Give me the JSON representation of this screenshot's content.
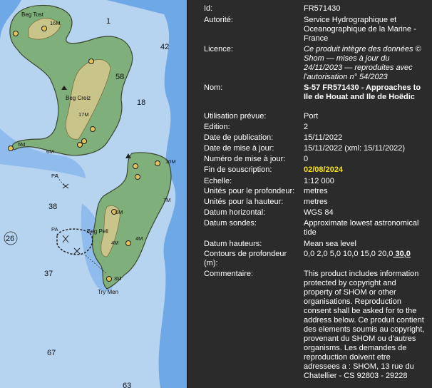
{
  "chart_map": {
    "place_labels": [
      "Beg Tost",
      "Beg Creiz",
      "Beg Pell",
      "Try Men"
    ],
    "heights": [
      "16M",
      "17M",
      "6M",
      "5M",
      "10M",
      "7M",
      "4M",
      "4M",
      "3M",
      "6M"
    ],
    "depths": [
      "1",
      "42",
      "58",
      "18",
      "38",
      "26",
      "37",
      "67",
      "63"
    ],
    "markers": [
      "PA",
      "PA"
    ],
    "colors": {
      "sea_deep": "#b6d3f0",
      "sea_shallow": "#6fa8e6",
      "land": "#7faf7a",
      "dry": "#c9c48a"
    }
  },
  "metadata": [
    {
      "key": "Id:",
      "value": "FR571430"
    },
    {
      "key": "Autorité:",
      "value": "Service Hydrographique et Oceanographique de la Marine - France"
    },
    {
      "key": "Licence:",
      "value": "Ce produit intègre des données © Shom — mises à jour du 24/11/2023 — reproduites avec l'autorisation n° 54/2023"
    },
    {
      "key": "Nom:",
      "value": "S-57 FR571430 - Approaches to Ile de Houat and Ile de Hoëdic"
    },
    {
      "key": "Utilisation prévue:",
      "value": "Port"
    },
    {
      "key": "Edition:",
      "value": "2"
    },
    {
      "key": "Date de publication:",
      "value": "15/11/2022"
    },
    {
      "key": "Date de mise à jour:",
      "value": "15/11/2022 (xml: 15/11/2022)"
    },
    {
      "key": "Numéro de mise à jour:",
      "value": "0"
    },
    {
      "key": "Fin de souscription:",
      "value": "02/08/2024"
    },
    {
      "key": "Echelle:",
      "value": "1:12 000"
    },
    {
      "key": "Unités pour le profondeur:",
      "value": "metres"
    },
    {
      "key": "Unités pour la hauteur:",
      "value": "metres"
    },
    {
      "key": "Datum horizontal:",
      "value": "WGS 84"
    },
    {
      "key": "Datum sondes:",
      "value": "Approximate lowest astronomical tide"
    },
    {
      "key": "Datum hauteurs:",
      "value": "Mean sea level"
    },
    {
      "key": "Contours de profondeur (m):",
      "value": "0,0 2,0 5,0 10,0 15,0 20,0",
      "value_emph": "30,0"
    },
    {
      "key": "Commentaire:",
      "value": "This product includes information protected by copyright and property of SHOM or other organisations. Reproduction consent shall be asked for to the address below. Ce produit contient des elements soumis au copyright, provenant du SHOM ou d'autres organisms. Les demandes de reproduction doivent etre adressees a : SHOM, 13 rue du Chatellier - CS 92803 - 29228"
    }
  ]
}
